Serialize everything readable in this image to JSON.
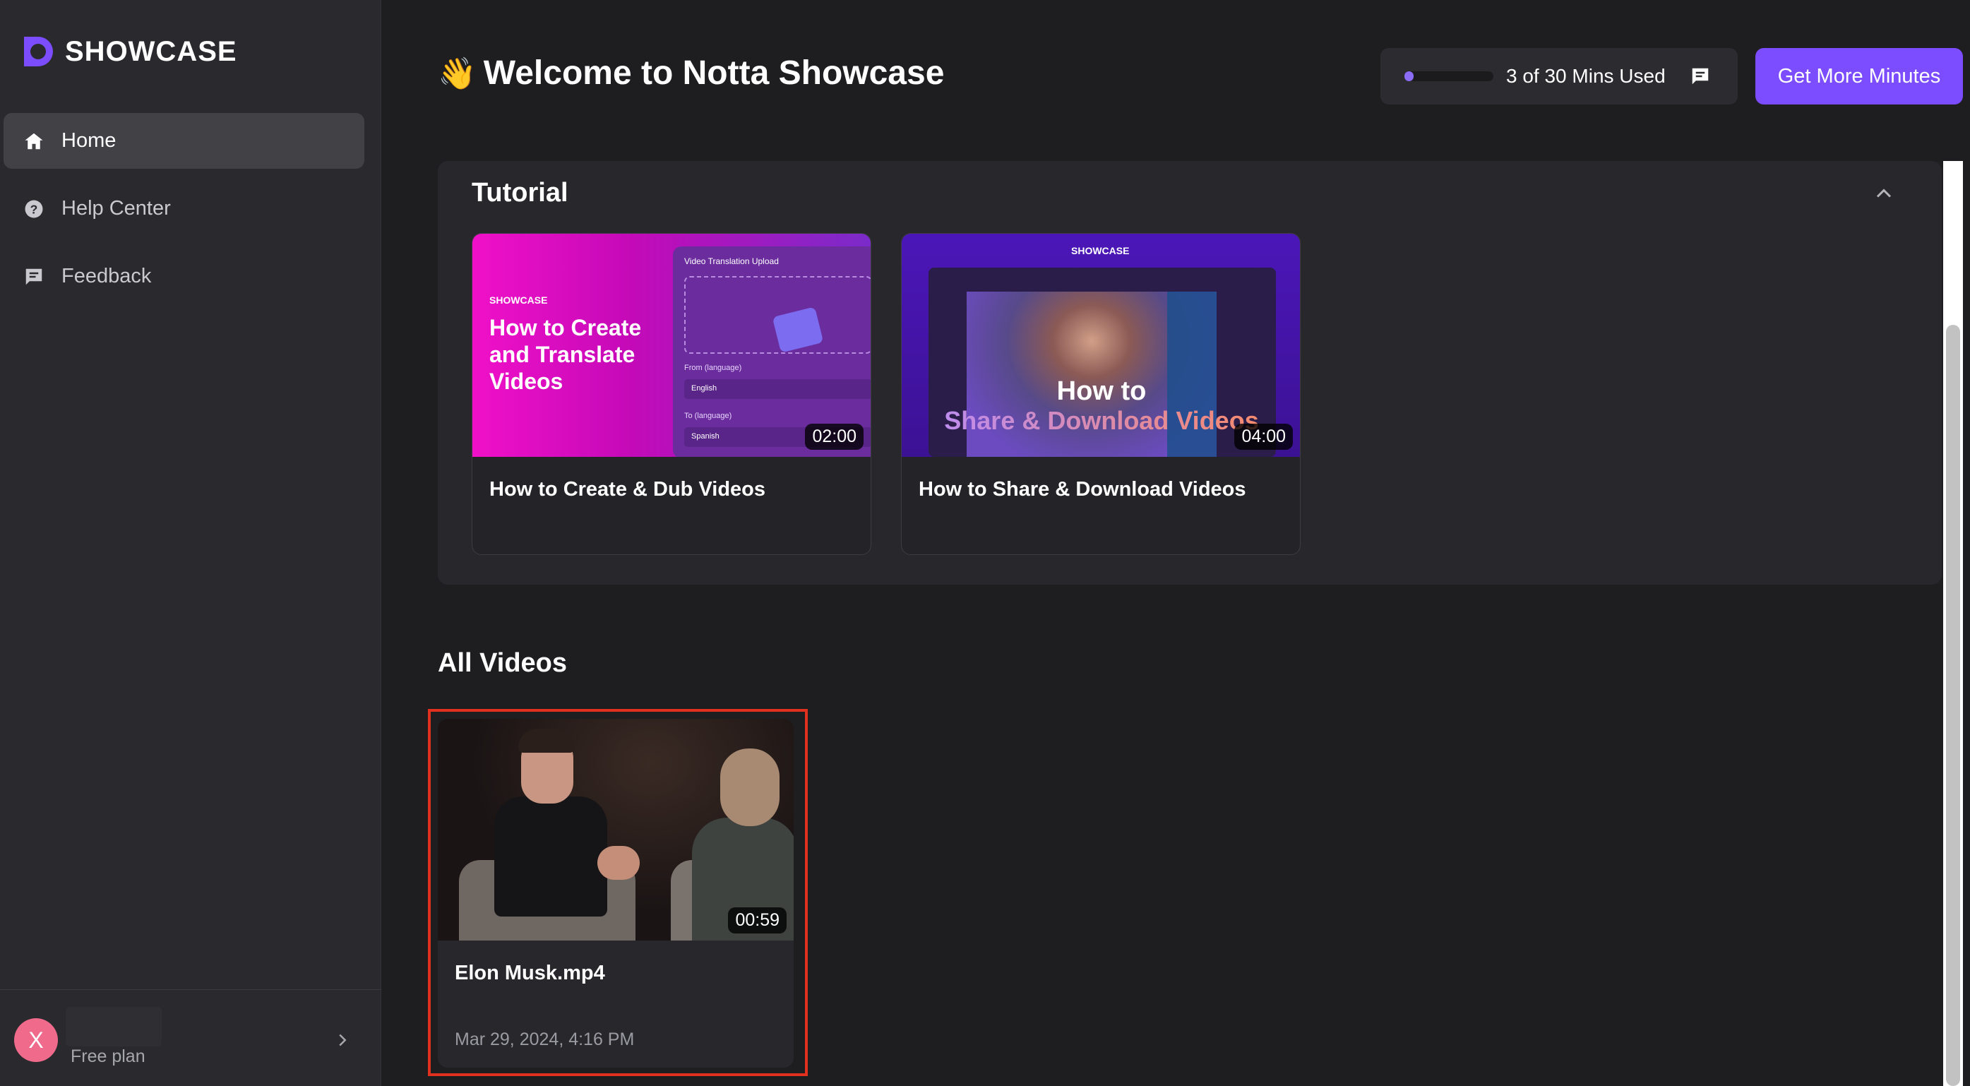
{
  "sidebar": {
    "logo_text": "SHOWCASE",
    "items": [
      {
        "label": "Home",
        "icon": "home-icon",
        "active": true
      },
      {
        "label": "Help Center",
        "icon": "help-circle-icon",
        "active": false
      },
      {
        "label": "Feedback",
        "icon": "feedback-icon",
        "active": false
      }
    ],
    "user": {
      "avatar_letter": "X",
      "plan": "Free plan"
    }
  },
  "header": {
    "wave": "👋",
    "title": "Welcome to Notta Showcase",
    "usage": {
      "text": "3 of 30 Mins Used",
      "used": 3,
      "total": 30
    },
    "cta_label": "Get More Minutes"
  },
  "tutorial": {
    "title": "Tutorial",
    "videos": [
      {
        "title": "How to Create & Dub Videos",
        "duration": "02:00",
        "thumb": {
          "brand": "SHOWCASE",
          "headline": "How to Create and Translate Videos",
          "panel_title": "Video Translation Upload",
          "from_label": "From (language)",
          "from_value": "English",
          "to_label": "To (language)",
          "to_value": "Spanish"
        }
      },
      {
        "title": "How to Share & Download Videos",
        "duration": "04:00",
        "thumb": {
          "brand": "SHOWCASE",
          "line1": "How to",
          "line2": "Share & Download Videos"
        }
      }
    ]
  },
  "all_videos": {
    "title": "All Videos",
    "items": [
      {
        "title": "Elon Musk.mp4",
        "duration": "00:59",
        "date": "Mar 29, 2024, 4:16 PM"
      }
    ]
  },
  "colors": {
    "accent": "#7c4dff",
    "background": "#1e1e21",
    "sidebar": "#2a2a2e",
    "highlight": "#e0301e"
  }
}
